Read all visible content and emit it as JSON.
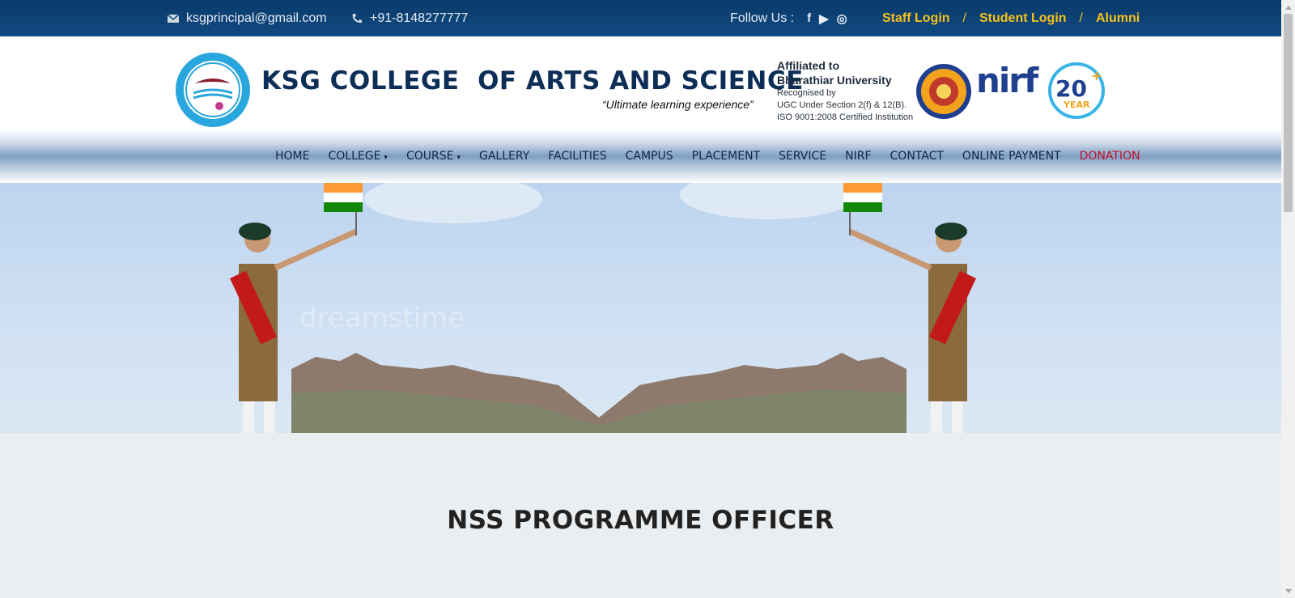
{
  "topbar": {
    "email": "ksgprincipal@gmail.com",
    "phone": "+91-8148277777",
    "follow_label": "Follow Us :",
    "social": [
      {
        "icon": "facebook-icon",
        "glyph": "f"
      },
      {
        "icon": "youtube-icon",
        "glyph": "▶"
      },
      {
        "icon": "instagram-icon",
        "glyph": "◎"
      }
    ],
    "staff_login": "Staff Login",
    "student_login": "Student Login",
    "alumni": "Alumni",
    "separator": "/"
  },
  "header": {
    "college_name": "KSG COLLEGE  OF ARTS AND SCIENCE",
    "tagline": "“Ultimate learning experience”",
    "affiliation_line1": "Affiliated to",
    "affiliation_line2": "Bharathiar University",
    "affiliation_line3": "Recognised by",
    "affiliation_line4": "UGC Under Section 2(f) & 12(B).",
    "affiliation_line5": "ISO 9001:2008 Certified Institution",
    "nirf_text": "nirf",
    "year_badge_number": "20",
    "year_badge_label": "YEAR"
  },
  "nav": {
    "items": [
      {
        "label": "HOME",
        "dropdown": false
      },
      {
        "label": "COLLEGE",
        "dropdown": true
      },
      {
        "label": "COURSE",
        "dropdown": true
      },
      {
        "label": "GALLERY",
        "dropdown": false
      },
      {
        "label": "FACILITIES",
        "dropdown": false
      },
      {
        "label": "CAMPUS",
        "dropdown": false
      },
      {
        "label": "PLACEMENT",
        "dropdown": false
      },
      {
        "label": "SERVICE",
        "dropdown": false
      },
      {
        "label": "NIRF",
        "dropdown": false
      },
      {
        "label": "CONTACT",
        "dropdown": false
      },
      {
        "label": "ONLINE PAYMENT",
        "dropdown": false
      },
      {
        "label": "DONATION",
        "dropdown": false
      }
    ]
  },
  "hero": {
    "watermark": "dreamstime"
  },
  "page": {
    "title": "NSS PROGRAMME OFFICER"
  },
  "colors": {
    "topbar": "#0f4a80",
    "login_accent": "#f6c21a",
    "brand_navy": "#0d2e57",
    "donation_red": "#c0122b"
  }
}
